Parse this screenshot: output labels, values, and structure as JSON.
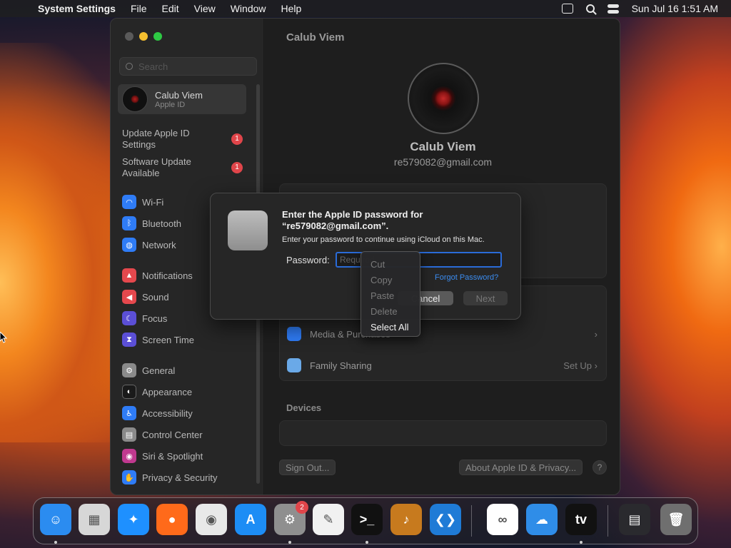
{
  "menubar": {
    "app_name": "System Settings",
    "items": [
      "File",
      "Edit",
      "View",
      "Window",
      "Help"
    ],
    "clock": "Sun Jul 16  1:51 AM"
  },
  "sidebar": {
    "search_placeholder": "Search",
    "profile": {
      "name": "Calub Viem",
      "subtitle": "Apple ID"
    },
    "notices": [
      {
        "label": "Update Apple ID Settings",
        "badge": "1"
      },
      {
        "label": "Software Update Available",
        "badge": "1"
      }
    ],
    "items": [
      {
        "label": "Wi-Fi",
        "icon": "wifi-icon",
        "color": "#2f7cf6"
      },
      {
        "label": "Bluetooth",
        "icon": "bluetooth-icon",
        "color": "#2f7cf6"
      },
      {
        "label": "Network",
        "icon": "globe-icon",
        "color": "#2f7cf6"
      },
      {
        "label": "Notifications",
        "icon": "bell-icon",
        "color": "#e5484d"
      },
      {
        "label": "Sound",
        "icon": "speaker-icon",
        "color": "#e5484d"
      },
      {
        "label": "Focus",
        "icon": "moon-icon",
        "color": "#5b4fd6"
      },
      {
        "label": "Screen Time",
        "icon": "hourglass-icon",
        "color": "#5b4fd6"
      },
      {
        "label": "General",
        "icon": "gear-icon",
        "color": "#8a8a8a"
      },
      {
        "label": "Appearance",
        "icon": "appearance-icon",
        "color": "#1a1a1a"
      },
      {
        "label": "Accessibility",
        "icon": "accessibility-icon",
        "color": "#2f7cf6"
      },
      {
        "label": "Control Center",
        "icon": "control-center-icon",
        "color": "#8a8a8a"
      },
      {
        "label": "Siri & Spotlight",
        "icon": "siri-icon",
        "color": "#c0398f"
      },
      {
        "label": "Privacy & Security",
        "icon": "hand-icon",
        "color": "#2f7cf6"
      }
    ]
  },
  "main": {
    "title": "Calub Viem",
    "name": "Calub Viem",
    "email": "re579082@gmail.com",
    "rows": [
      {
        "label": "Media & Purchases",
        "right": ""
      },
      {
        "label": "Family Sharing",
        "right": "Set Up"
      }
    ],
    "devices_title": "Devices",
    "sign_out": "Sign Out...",
    "about": "About Apple ID & Privacy...",
    "help": "?"
  },
  "dialog": {
    "title": "Enter the Apple ID password for “re579082@gmail.com”.",
    "message": "Enter your password to continue using iCloud on this Mac.",
    "password_label": "Password:",
    "password_placeholder": "Required",
    "forgot": "Forgot Password?",
    "cancel": "Cancel",
    "next": "Next"
  },
  "context_menu": {
    "items": [
      {
        "label": "Cut",
        "enabled": false
      },
      {
        "label": "Copy",
        "enabled": false
      },
      {
        "label": "Paste",
        "enabled": false
      },
      {
        "label": "Delete",
        "enabled": false
      },
      {
        "label": "Select All",
        "enabled": true
      }
    ]
  },
  "dock": {
    "items": [
      {
        "name": "finder-icon",
        "glyph": "☺",
        "color": "#2b8cf0",
        "running": true
      },
      {
        "name": "launchpad-icon",
        "glyph": "▦",
        "color": "#d7d7d7",
        "running": false
      },
      {
        "name": "safari-icon",
        "glyph": "✦",
        "color": "#1e90ff",
        "running": false
      },
      {
        "name": "firefox-icon",
        "glyph": "●",
        "color": "#ff6a1a",
        "running": false
      },
      {
        "name": "chrome-icon",
        "glyph": "◉",
        "color": "#e8e8e8",
        "running": false
      },
      {
        "name": "app-store-icon",
        "glyph": "A",
        "color": "#1d8df5",
        "running": false
      },
      {
        "name": "system-settings-icon",
        "glyph": "⚙",
        "color": "#8f8f8f",
        "running": true,
        "badge": "2"
      },
      {
        "name": "textedit-icon",
        "glyph": "✎",
        "color": "#f1f1f1",
        "running": false
      },
      {
        "name": "terminal-icon",
        "glyph": ">_",
        "color": "#111111",
        "running": true
      },
      {
        "name": "garageband-icon",
        "glyph": "♪",
        "color": "#c77a1e",
        "running": false
      },
      {
        "name": "vscode-icon",
        "glyph": "❮❯",
        "color": "#1f7bd6",
        "running": false
      },
      {
        "name": "visual-studio-icon",
        "glyph": "∞",
        "color": "#ffffff",
        "running": false
      },
      {
        "name": "weather-icon",
        "glyph": "☁",
        "color": "#2f8de8",
        "running": false
      },
      {
        "name": "apple-tv-icon",
        "glyph": "tv",
        "color": "#111111",
        "running": true
      },
      {
        "name": "downloads-folder-icon",
        "glyph": "▤",
        "color": "#2a2a2e",
        "running": false
      },
      {
        "name": "trash-icon",
        "glyph": "🗑",
        "color": "#6f6f6f",
        "running": false
      }
    ]
  }
}
